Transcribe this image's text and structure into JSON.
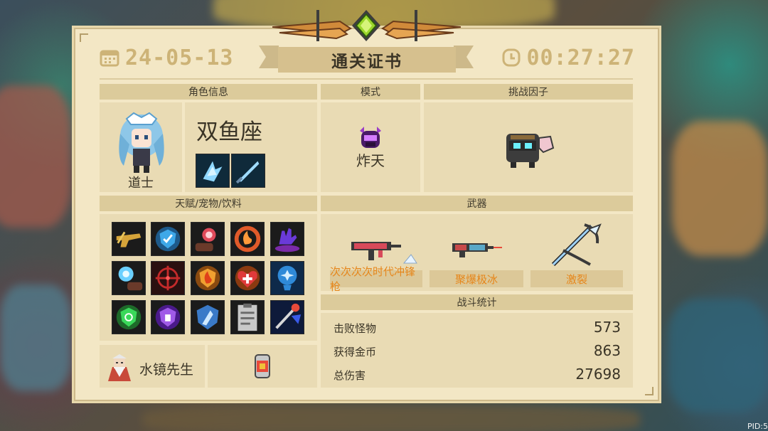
{
  "header": {
    "date": "24-05-13",
    "title": "通关证书",
    "time": "00:27:27"
  },
  "sections": {
    "character_info": "角色信息",
    "mode": "模式",
    "challenge_factor": "挑战因子",
    "talents_pets_drinks": "天赋/宠物/饮料",
    "weapons": "武器",
    "battle_stats": "战斗统计"
  },
  "character": {
    "name": "双鱼座",
    "class": "道士",
    "skin_icon": "pisces-character-icon",
    "skills": [
      "ice-wings-skill-icon",
      "ice-sword-skill-icon"
    ]
  },
  "mode": {
    "icon": "purple-helmet-icon",
    "label": "炸天"
  },
  "challenge_factor": {
    "icon": "robot-pig-icon"
  },
  "talents": [
    "golden-rifle-talent-icon",
    "blue-shield-talent-icon",
    "red-orb-talent-icon",
    "flame-ring-talent-icon",
    "purple-hand-talent-icon",
    "blue-orb-talent-icon",
    "red-crosshair-talent-icon",
    "fire-shield-talent-icon",
    "heart-cross-talent-icon",
    "blue-brain-talent-icon",
    "green-shield-talent-icon",
    "purple-shield-talent-icon",
    "ice-shield-talent-icon",
    "clipboard-talent-icon",
    "magic-staff-talent-icon"
  ],
  "pet": {
    "icon": "old-sage-pet-icon",
    "name": "水镜先生"
  },
  "drink": {
    "icon": "drink-can-icon"
  },
  "weapons": [
    {
      "icon": "red-rifle-weapon-icon",
      "name": "次次次次时代冲锋枪"
    },
    {
      "icon": "frost-gun-weapon-icon",
      "name": "聚爆极冰"
    },
    {
      "icon": "ice-crossbow-weapon-icon",
      "name": "激裂"
    }
  ],
  "stats": [
    {
      "label": "击败怪物",
      "value": "573"
    },
    {
      "label": "获得金币",
      "value": "863"
    },
    {
      "label": "总伤害",
      "value": "27698"
    }
  ],
  "footer": {
    "pid": "PID:5"
  },
  "colors": {
    "card_bg": "#f3e7c5",
    "header_bar": "#dccb9b",
    "weapon_label": "#e6861a",
    "date_text": "#cdb377"
  }
}
